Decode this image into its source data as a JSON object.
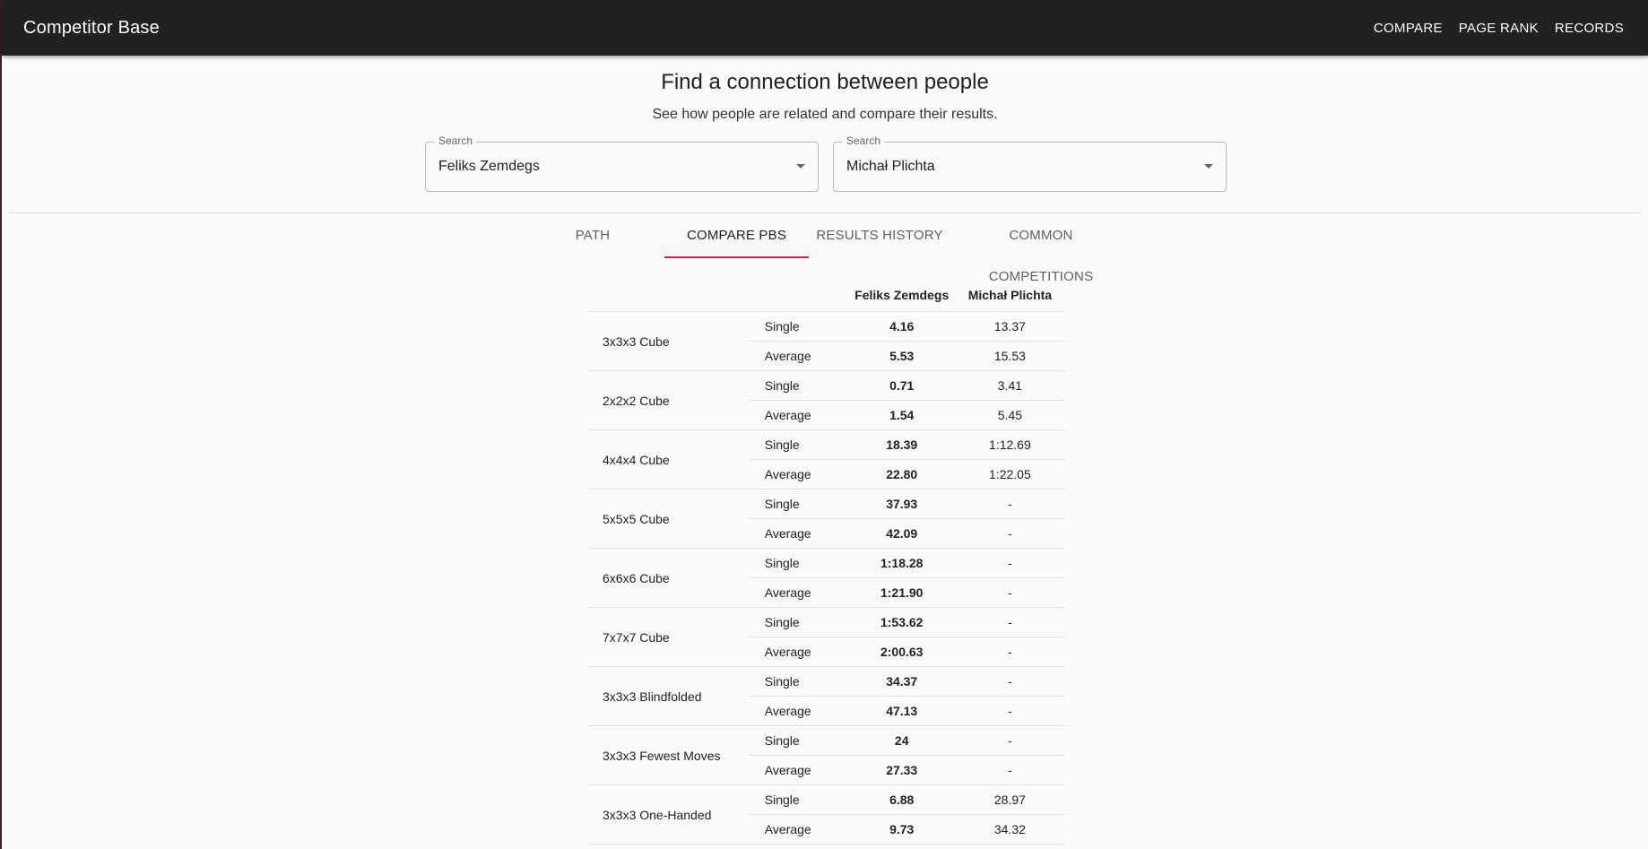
{
  "app": {
    "title": "Competitor Base",
    "nav": [
      "COMPARE",
      "PAGE RANK",
      "RECORDS"
    ]
  },
  "page": {
    "heading": "Find a connection between people",
    "subheading": "See how people are related and compare their results."
  },
  "search": [
    {
      "label": "Search",
      "value": "Feliks Zemdegs"
    },
    {
      "label": "Search",
      "value": "Michał Plichta"
    }
  ],
  "tabs": [
    {
      "label": "PATH",
      "active": false
    },
    {
      "label": "COMPARE PBS",
      "active": true
    },
    {
      "label": "RESULTS HISTORY",
      "active": false
    },
    {
      "label": "COMMON COMPETITIONS",
      "active": false
    }
  ],
  "table": {
    "columns": [
      "Feliks Zemdegs",
      "Michał Plichta"
    ],
    "single_label": "Single",
    "average_label": "Average",
    "rows": [
      {
        "event": "3x3x3 Cube",
        "single": [
          "4.16",
          "13.37"
        ],
        "average": [
          "5.53",
          "15.53"
        ]
      },
      {
        "event": "2x2x2 Cube",
        "single": [
          "0.71",
          "3.41"
        ],
        "average": [
          "1.54",
          "5.45"
        ]
      },
      {
        "event": "4x4x4 Cube",
        "single": [
          "18.39",
          "1:12.69"
        ],
        "average": [
          "22.80",
          "1:22.05"
        ]
      },
      {
        "event": "5x5x5 Cube",
        "single": [
          "37.93",
          "-"
        ],
        "average": [
          "42.09",
          "-"
        ]
      },
      {
        "event": "6x6x6 Cube",
        "single": [
          "1:18.28",
          "-"
        ],
        "average": [
          "1:21.90",
          "-"
        ]
      },
      {
        "event": "7x7x7 Cube",
        "single": [
          "1:53.62",
          "-"
        ],
        "average": [
          "2:00.63",
          "-"
        ]
      },
      {
        "event": "3x3x3 Blindfolded",
        "single": [
          "34.37",
          "-"
        ],
        "average": [
          "47.13",
          "-"
        ]
      },
      {
        "event": "3x3x3 Fewest Moves",
        "single": [
          "24",
          "-"
        ],
        "average": [
          "27.33",
          "-"
        ]
      },
      {
        "event": "3x3x3 One-Handed",
        "single": [
          "6.88",
          "28.97"
        ],
        "average": [
          "9.73",
          "34.32"
        ]
      }
    ]
  }
}
